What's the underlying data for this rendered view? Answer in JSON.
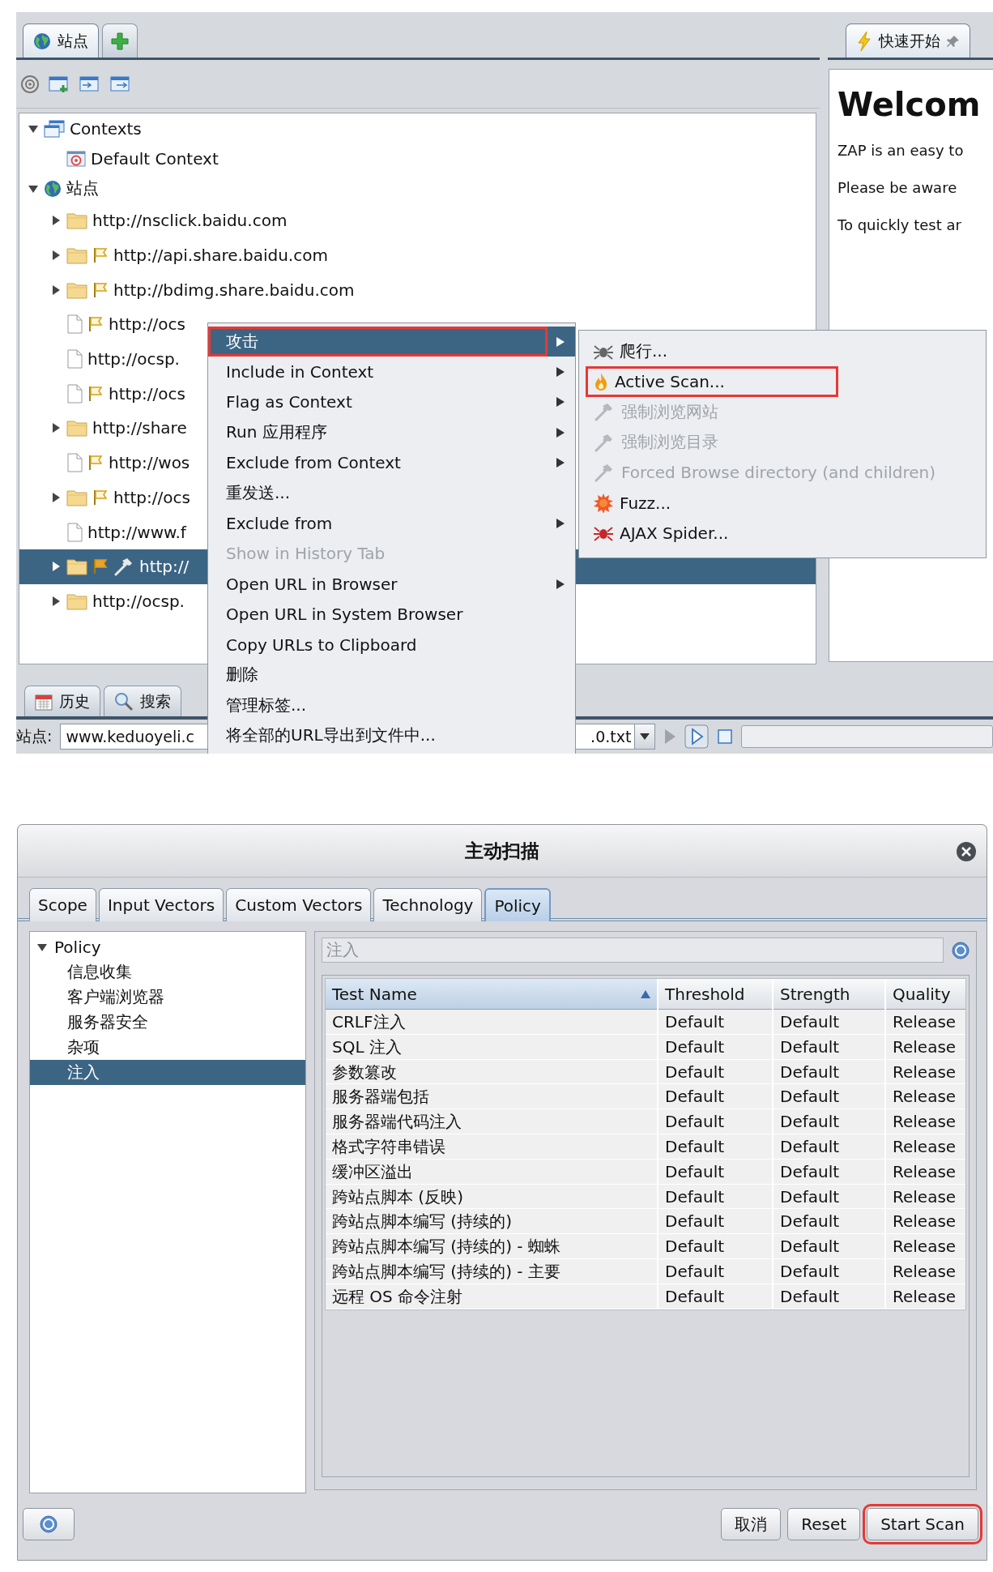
{
  "workspace": {
    "sites_tab": {
      "label": "站点",
      "selected": true
    },
    "quick_start_tab": {
      "label": "快速开始",
      "selected": true
    },
    "tree": [
      {
        "label": "Contexts",
        "kind": "contexts",
        "expanded": true,
        "selected": false,
        "children": [
          {
            "label": "Default Context",
            "kind": "context",
            "selected": false
          }
        ]
      },
      {
        "label": "站点",
        "kind": "globe",
        "expanded": true,
        "selected": false,
        "children": [
          {
            "label": "http://nsclick.baidu.com",
            "kind": "folder",
            "expanded": false,
            "flagged": false,
            "tool_mark": false,
            "selected": false
          },
          {
            "label": "http://api.share.baidu.com",
            "kind": "folder",
            "expanded": false,
            "flagged": true,
            "tool_mark": false,
            "selected": false
          },
          {
            "label": "http://bdimg.share.baidu.com",
            "kind": "folder",
            "expanded": false,
            "flagged": true,
            "tool_mark": false,
            "selected": false
          },
          {
            "label": "http://ocs",
            "kind": "file",
            "flagged": true,
            "tool_mark": false,
            "selected": false
          },
          {
            "label": "http://ocsp.",
            "kind": "file",
            "flagged": false,
            "tool_mark": false,
            "selected": false
          },
          {
            "label": "http://ocs",
            "kind": "file",
            "flagged": true,
            "tool_mark": false,
            "selected": false
          },
          {
            "label": "http://share",
            "kind": "folder",
            "expanded": false,
            "flagged": false,
            "tool_mark": false,
            "selected": false
          },
          {
            "label": "http://wos",
            "kind": "file",
            "flagged": true,
            "tool_mark": false,
            "selected": false
          },
          {
            "label": "http://ocs",
            "kind": "folder",
            "expanded": false,
            "flagged": true,
            "tool_mark": false,
            "selected": false
          },
          {
            "label": "http://www.f",
            "kind": "file",
            "flagged": false,
            "tool_mark": false,
            "selected": false
          },
          {
            "label": "http://",
            "kind": "folder",
            "expanded": false,
            "flagged": true,
            "tool_mark": true,
            "selected": true
          },
          {
            "label": "http://ocsp.",
            "kind": "folder",
            "expanded": false,
            "flagged": false,
            "tool_mark": false,
            "selected": false
          }
        ]
      }
    ],
    "welcome": {
      "heading": "Welcom",
      "paragraphs": [
        "ZAP is an easy to",
        "Please be aware",
        "To quickly test ar"
      ]
    },
    "bottom_tabs": [
      {
        "label": "历史",
        "kind": "calendar",
        "selected": false
      },
      {
        "label": "搜索",
        "kind": "search",
        "selected": false
      }
    ],
    "status_bar": {
      "site_label": "站点:",
      "site_value": "www.keduoyeli.c",
      "file_value": ".0.txt"
    },
    "context_menu": {
      "highlight_selected": true,
      "items": [
        {
          "label": "攻击",
          "submenu": true,
          "disabled": false,
          "selected": true
        },
        {
          "label": "Include in Context",
          "submenu": true,
          "disabled": false,
          "selected": false
        },
        {
          "label": "Flag as Context",
          "submenu": true,
          "disabled": false,
          "selected": false
        },
        {
          "label": "Run 应用程序",
          "submenu": true,
          "disabled": false,
          "selected": false
        },
        {
          "label": "Exclude from Context",
          "submenu": true,
          "disabled": false,
          "selected": false
        },
        {
          "label": "重发送...",
          "submenu": false,
          "disabled": false,
          "selected": false
        },
        {
          "label": "Exclude from",
          "submenu": true,
          "disabled": false,
          "selected": false
        },
        {
          "label": "Show in History Tab",
          "submenu": false,
          "disabled": true,
          "selected": false
        },
        {
          "label": "Open URL in Browser",
          "submenu": true,
          "disabled": false,
          "selected": false
        },
        {
          "label": "Open URL in System Browser",
          "submenu": false,
          "disabled": false,
          "selected": false
        },
        {
          "label": "Copy URLs to Clipboard",
          "submenu": false,
          "disabled": false,
          "selected": false
        },
        {
          "label": "删除",
          "submenu": false,
          "disabled": false,
          "selected": false
        },
        {
          "label": "管理标签...",
          "submenu": false,
          "disabled": false,
          "selected": false
        },
        {
          "label": "将全部的URL导出到文件中...",
          "submenu": false,
          "disabled": false,
          "selected": false
        }
      ]
    },
    "submenu": {
      "items": [
        {
          "label": "爬行...",
          "kind": "spider",
          "disabled": false,
          "highlighted": false
        },
        {
          "label": "Active Scan...",
          "kind": "flame",
          "disabled": false,
          "highlighted": true
        },
        {
          "label": "强制浏览网站",
          "kind": "hammer",
          "disabled": true,
          "highlighted": false
        },
        {
          "label": "强制浏览目录",
          "kind": "hammer",
          "disabled": true,
          "highlighted": false
        },
        {
          "label": "Forced Browse directory (and children)",
          "kind": "hammer",
          "disabled": true,
          "highlighted": false
        },
        {
          "label": "Fuzz...",
          "kind": "burst",
          "disabled": false,
          "highlighted": false
        },
        {
          "label": "AJAX Spider...",
          "kind": "red_spider",
          "disabled": false,
          "highlighted": false
        }
      ]
    }
  },
  "dialog": {
    "title": "主动扫描",
    "tabs": [
      {
        "label": "Scope",
        "selected": false
      },
      {
        "label": "Input Vectors",
        "selected": false
      },
      {
        "label": "Custom Vectors",
        "selected": false
      },
      {
        "label": "Technology",
        "selected": false
      },
      {
        "label": "Policy",
        "selected": true
      }
    ],
    "policy_tree": {
      "label": "Policy",
      "expanded": true,
      "children": [
        {
          "label": "信息收集",
          "selected": false
        },
        {
          "label": "客户端浏览器",
          "selected": false
        },
        {
          "label": "服务器安全",
          "selected": false
        },
        {
          "label": "杂项",
          "selected": false
        },
        {
          "label": "注入",
          "selected": true
        }
      ]
    },
    "filter": {
      "value": "注入",
      "disabled": true
    },
    "columns": [
      {
        "label": "Test Name",
        "sorted": true
      },
      {
        "label": "Threshold",
        "sorted": false
      },
      {
        "label": "Strength",
        "sorted": false
      },
      {
        "label": "Quality",
        "sorted": false
      }
    ],
    "rows": [
      {
        "test_name": "CRLF注入",
        "threshold": "Default",
        "strength": "Default",
        "quality": "Release"
      },
      {
        "test_name": "SQL 注入",
        "threshold": "Default",
        "strength": "Default",
        "quality": "Release"
      },
      {
        "test_name": "参数篡改",
        "threshold": "Default",
        "strength": "Default",
        "quality": "Release"
      },
      {
        "test_name": "服务器端包括",
        "threshold": "Default",
        "strength": "Default",
        "quality": "Release"
      },
      {
        "test_name": "服务器端代码注入",
        "threshold": "Default",
        "strength": "Default",
        "quality": "Release"
      },
      {
        "test_name": "格式字符串错误",
        "threshold": "Default",
        "strength": "Default",
        "quality": "Release"
      },
      {
        "test_name": "缓冲区溢出",
        "threshold": "Default",
        "strength": "Default",
        "quality": "Release"
      },
      {
        "test_name": "跨站点脚本 (反映)",
        "threshold": "Default",
        "strength": "Default",
        "quality": "Release"
      },
      {
        "test_name": "跨站点脚本编写 (持续的)",
        "threshold": "Default",
        "strength": "Default",
        "quality": "Release"
      },
      {
        "test_name": "跨站点脚本编写 (持续的) - 蜘蛛",
        "threshold": "Default",
        "strength": "Default",
        "quality": "Release"
      },
      {
        "test_name": "跨站点脚本编写 (持续的) - 主要",
        "threshold": "Default",
        "strength": "Default",
        "quality": "Release"
      },
      {
        "test_name": "远程 OS 命令注射",
        "threshold": "Default",
        "strength": "Default",
        "quality": "Release"
      }
    ],
    "buttons": [
      {
        "label": "取消",
        "highlighted": false
      },
      {
        "label": "Reset",
        "highlighted": false
      },
      {
        "label": "Start Scan",
        "highlighted": true
      }
    ]
  }
}
